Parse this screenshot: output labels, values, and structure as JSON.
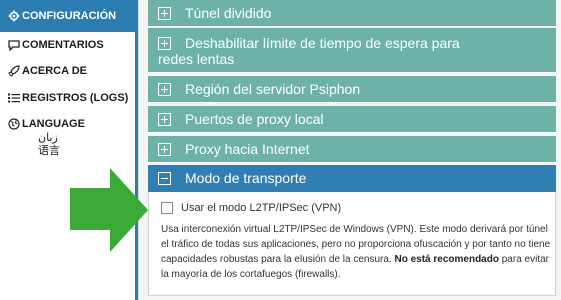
{
  "sidebar": {
    "items": [
      {
        "label": "CONFIGURACIÓN",
        "icon": "gear-icon"
      },
      {
        "label": "COMENTARIOS",
        "icon": "speech-bubble-icon"
      },
      {
        "label": "ACERCA DE",
        "icon": "rocket-icon"
      },
      {
        "label": "REGISTROS (LOGS)",
        "icon": "list-icon"
      },
      {
        "label": "LANGUAGE",
        "icon": "globe-icon"
      }
    ],
    "language_alts": [
      "زبان",
      "语言"
    ]
  },
  "panels": [
    {
      "label": "Túnel dividido",
      "state": "collapsed"
    },
    {
      "label": "Deshabilitar límite de tiempo de espera para redes lentas",
      "state": "collapsed"
    },
    {
      "label": "Región del servidor Psiphon",
      "state": "collapsed"
    },
    {
      "label": "Puertos de proxy local",
      "state": "collapsed"
    },
    {
      "label": "Proxy hacia Internet",
      "state": "collapsed"
    },
    {
      "label": "Modo de transporte",
      "state": "expanded"
    }
  ],
  "transport": {
    "checkbox_label": "Usar el modo L2TP/IPSec (VPN)",
    "checked": false,
    "desc_part1": "Usa interconexión virtual L2TP/IPSec de Windows (VPN). Este modo derivará por túnel el tráfico de todas sus aplicaciones, pero no proporciona ofuscación y por tanto no tiene capacidades robustas para la elusión de la censura.",
    "desc_bold": "No está recomendado",
    "desc_part2": "para evitar la mayoría de los cortafuegos (firewalls)."
  },
  "colors": {
    "accent": "#2b7cb0",
    "panel": "#6db2a6",
    "arrow": "#3aaa35"
  }
}
